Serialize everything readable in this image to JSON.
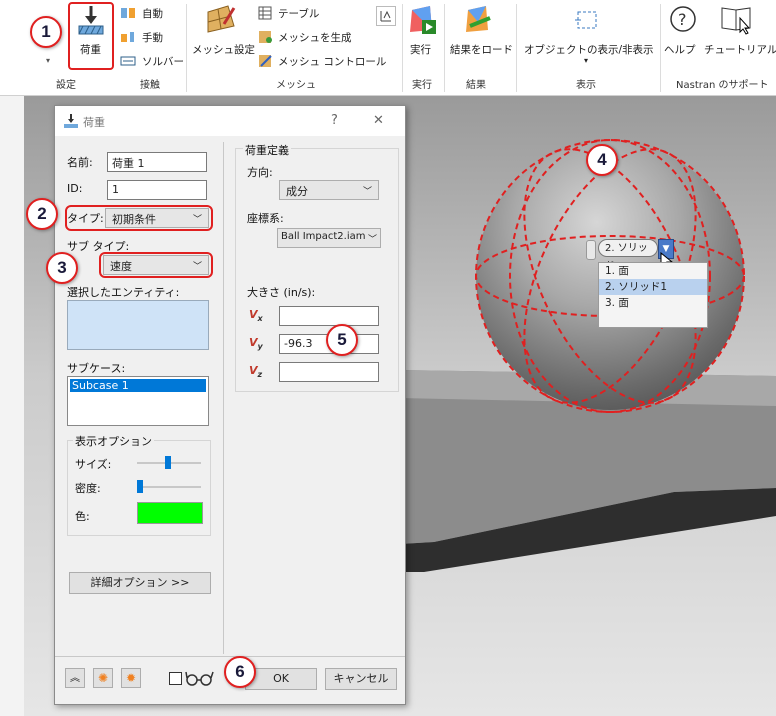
{
  "ribbon": {
    "groups": {
      "setup": "設定",
      "contact": "接触",
      "mesh": "メッシュ",
      "run": "実行",
      "results": "結果",
      "display": "表示",
      "support": "Nastran のサポート"
    },
    "load_button": "荷重",
    "auto": "自動",
    "manual": "手動",
    "solver": "ソルバー",
    "mesh_settings": "メッシュ設定",
    "table": "テーブル",
    "generate_mesh": "メッシュを生成",
    "mesh_control": "メッシュ コントロール",
    "run_button": "実行",
    "load_results": "結果をロード",
    "show_hide_objects": "オブジェクトの表示/非表示",
    "help": "ヘルプ",
    "tutorial": "チュートリアル"
  },
  "dialog": {
    "title": "荷重",
    "help_glyph": "?",
    "close_glyph": "✕",
    "name_label": "名前:",
    "name_value": "荷重 1",
    "id_label": "ID:",
    "id_value": "1",
    "type_label": "タイプ:",
    "type_value": "初期条件",
    "subtype_label": "サブ タイプ:",
    "subtype_value": "速度",
    "selected_entities_label": "選択したエンティティ:",
    "subcase_label": "サブケース:",
    "subcase_item": "Subcase 1",
    "display_options_label": "表示オプション",
    "size_label": "サイズ:",
    "density_label": "密度:",
    "color_label": "色:",
    "color_value": "#00ff00",
    "advanced_button": "詳細オプション >>",
    "load_definition_label": "荷重定義",
    "direction_label": "方向:",
    "direction_value": "成分",
    "coord_label": "座標系:",
    "coord_value": "Ball Impact2.iam",
    "magnitude_label": "大きさ (in/s):",
    "vx_label": "V",
    "vx_sub": "x",
    "vx_value": "",
    "vy_label": "V",
    "vy_sub": "y",
    "vy_value": "-96.3",
    "vz_label": "V",
    "vz_sub": "z",
    "vz_value": "",
    "ok_button": "OK",
    "cancel_button": "キャンセル"
  },
  "picker": {
    "selected": "2. ソリッド1",
    "options": [
      "1. 面",
      "2. ソリッド1",
      "3. 面"
    ]
  },
  "callouts": [
    "1",
    "2",
    "3",
    "4",
    "5",
    "6"
  ],
  "colors": {
    "highlight": "#e02020",
    "selection": "#cfe3f7",
    "accent_swatch": "#00ff00"
  }
}
